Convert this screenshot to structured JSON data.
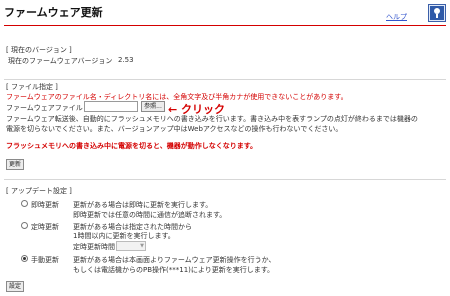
{
  "header": {
    "title": "ファームウェア更新",
    "help_link": "ヘルプ",
    "help_icon": "help-question-icon"
  },
  "current_version": {
    "section_title": "[ 現在のバージョン ]",
    "label": "現在のファームウェアバージョン",
    "value": "2.53"
  },
  "file_section": {
    "section_title": "[ ファイル指定 ]",
    "warning": "ファームウェアのファイル名・ディレクトリ名には、全角文字及び半角カナが使用できないことがあります。",
    "file_label": "ファームウェアファイル",
    "file_value": "",
    "browse_label": "参照...",
    "annotation": "← クリック",
    "info_line1": "ファームウェア転送後、自動的にフラッシュメモリへの書き込みを行います。書き込み中を表すランプの点灯が終わるまでは機器の",
    "info_line2": "電源を切らないでください。また、バージョンアップ中はWebアクセスなどの操作も行わないでください。",
    "caution": "フラッシュメモリへの書き込み中に電源を切ると、機器が動作しなくなります。",
    "update_button": "更新"
  },
  "auto_update": {
    "section_title": "[ アップデート設定 ]",
    "options": [
      {
        "label": "即時更新",
        "desc1": "更新がある場合は即時に更新を実行します。",
        "desc2": "即時更新では任意の時間に通信が追断されます。",
        "checked": false
      },
      {
        "label": "定時更新",
        "desc1": "更新がある場合は指定された時間から",
        "desc2": "1時間以内に更新を実行します。",
        "time_label": "定時更新時間",
        "time_value": "",
        "checked": false
      },
      {
        "label": "手動更新",
        "desc1": "更新がある場合は本画面よりファームウェア更新操作を行うか、",
        "desc2": "もしくは電話機からのPB操作(***11)により更新を実行します。",
        "checked": true
      }
    ],
    "settings_button": "設定"
  },
  "colors": {
    "accent_red": "#d40000",
    "link_blue": "#3355cc",
    "separator": "#d7d7d7"
  }
}
